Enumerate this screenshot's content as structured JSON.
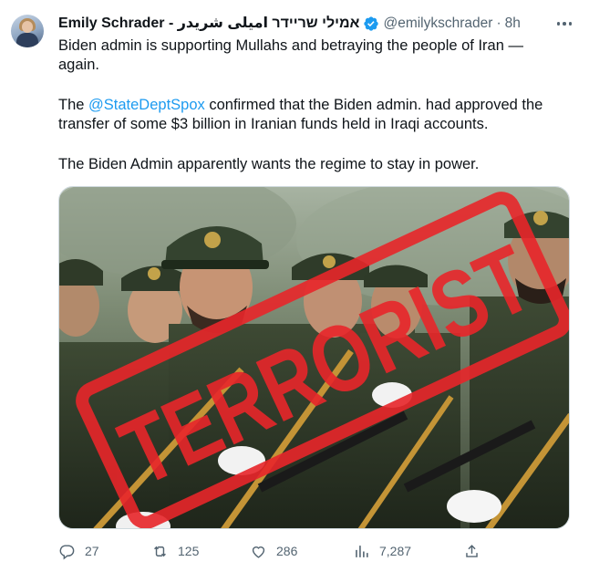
{
  "tweet": {
    "author_name": "Emily Schrader - אמילי שריידר امیلی شریدر",
    "handle": "@emilykschrader",
    "separator": "·",
    "time": "8h",
    "line1": "Biden admin is supporting Mullahs and betraying the people of Iran —",
    "line2": "again.",
    "p2_prefix": "The ",
    "mention": "@StateDeptSpox",
    "p2_suffix": " confirmed that the Biden admin. had approved the",
    "p2_line2": "transfer of some $3 billion in Iranian funds held in Iraqi accounts.",
    "p3": "The Biden Admin apparently wants the regime to stay in power.",
    "stamp_text": "TERRORIST"
  },
  "actions": {
    "replies": "27",
    "retweets": "125",
    "likes": "286",
    "views": "7,287"
  },
  "icons": {
    "verified": "verified-badge-icon",
    "more": "more-dots-icon",
    "reply": "reply-icon",
    "retweet": "retweet-icon",
    "like": "heart-icon",
    "views": "views-chart-icon",
    "share": "share-icon"
  },
  "colors": {
    "accent": "#1d9bf0",
    "muted": "#536471",
    "stamp": "#e8262a"
  }
}
